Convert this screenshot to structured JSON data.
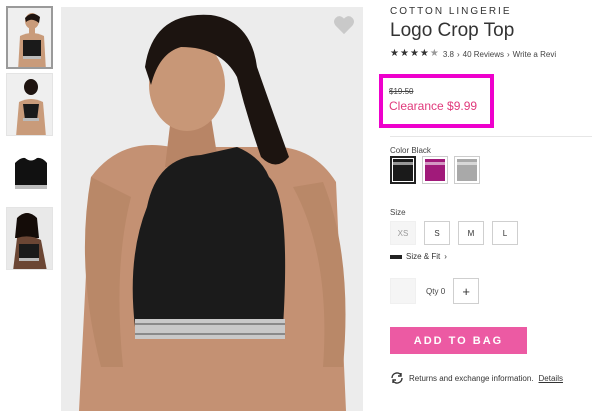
{
  "product": {
    "category": "COTTON LINGERIE",
    "title": "Logo Crop Top",
    "rating": "3.8",
    "reviews": "40 Reviews",
    "write_review": "Write a Revi",
    "original_price": "$19.50",
    "sale_price": "Clearance $9.99"
  },
  "color": {
    "label": "Color Black",
    "swatches": [
      {
        "name": "Black",
        "hex": "#1a1a1a",
        "selected": true
      },
      {
        "name": "Berry",
        "hex": "#a11a7a",
        "selected": false
      },
      {
        "name": "Grey",
        "hex": "#a9a9a9",
        "selected": false
      }
    ]
  },
  "size": {
    "label": "Size",
    "options": [
      {
        "label": "XS",
        "available": false
      },
      {
        "label": "S",
        "available": true
      },
      {
        "label": "M",
        "available": true
      },
      {
        "label": "L",
        "available": true
      }
    ],
    "size_fit_label": "Size & Fit"
  },
  "quantity": {
    "label": "Qty",
    "value": "0",
    "plus": "+"
  },
  "actions": {
    "add_to_bag": "ADD TO BAG",
    "returns_text": "Returns and exchange information.",
    "details_link": "Details"
  },
  "icons": {
    "favorite": "heart-icon",
    "size_fit": "ruler-icon",
    "returns": "refresh-icon"
  },
  "colors": {
    "accent_pink": "#ec5aa3",
    "sale_text": "#e0397b",
    "highlight_box": "#ee00cc"
  }
}
